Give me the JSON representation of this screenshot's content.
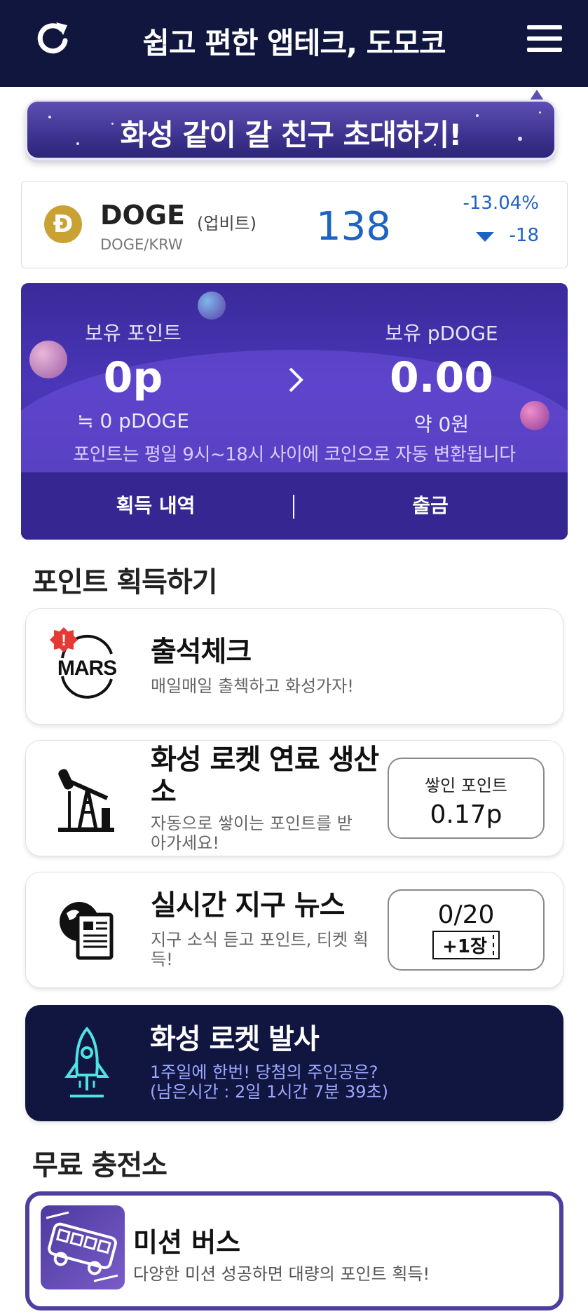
{
  "header": {
    "title": "쉽고 편한 앱테크, 도모코",
    "refresh_icon": "refresh-icon",
    "menu_icon": "hamburger-menu-icon"
  },
  "invite": {
    "label": "화성 같이 갈 친구 초대하기!"
  },
  "ticker": {
    "logo_glyph": "Ð",
    "name": "DOGE",
    "exchange": "(업비트)",
    "pair": "DOGE/KRW",
    "price": "138",
    "change_pct": "-13.04%",
    "change_abs": "-18",
    "color": "#1e63c4"
  },
  "points": {
    "held_points_label": "보유 포인트",
    "held_points_value": "0p",
    "held_points_sub": "≒ 0 pDOGE",
    "held_pdoge_label": "보유 pDOGE",
    "held_pdoge_value": "0.00",
    "held_pdoge_sub": "약 0원",
    "note": "포인트는 평일 9시~18시 사이에 코인으로 자동 변환됩니다",
    "history_button": "획득 내역",
    "withdraw_button": "출금"
  },
  "earn": {
    "section_title": "포인트 획득하기",
    "attendance": {
      "title": "출석체크",
      "desc": "매일매일 출첵하고 화성가자!",
      "logo": "MARS",
      "badge": "!"
    },
    "fuel": {
      "title_line1": "화성 로켓 연료 생산",
      "title_line2": "소",
      "desc_line1": "자동으로 쌓이는 포인트를 받",
      "desc_line2": "아가세요!",
      "box_label": "쌓인 포인트",
      "box_value": "0.17p"
    },
    "news": {
      "title": "실시간 지구 뉴스",
      "desc_line1": "지구 소식 듣고 포인트, 티켓 획",
      "desc_line2": "득!",
      "progress": "0/20",
      "ticket": "+1장"
    },
    "rocket": {
      "title": "화성 로켓 발사",
      "desc_line1": "1주일에 한번! 당첨의 주인공은?",
      "desc_line2": "(남은시간 : 2일 1시간 7분 39초)"
    }
  },
  "free": {
    "section_title": "무료 충전소",
    "bus": {
      "title": "미션 버스",
      "desc": "다양한 미션 성공하면 대량의 포인트 획득!"
    }
  }
}
